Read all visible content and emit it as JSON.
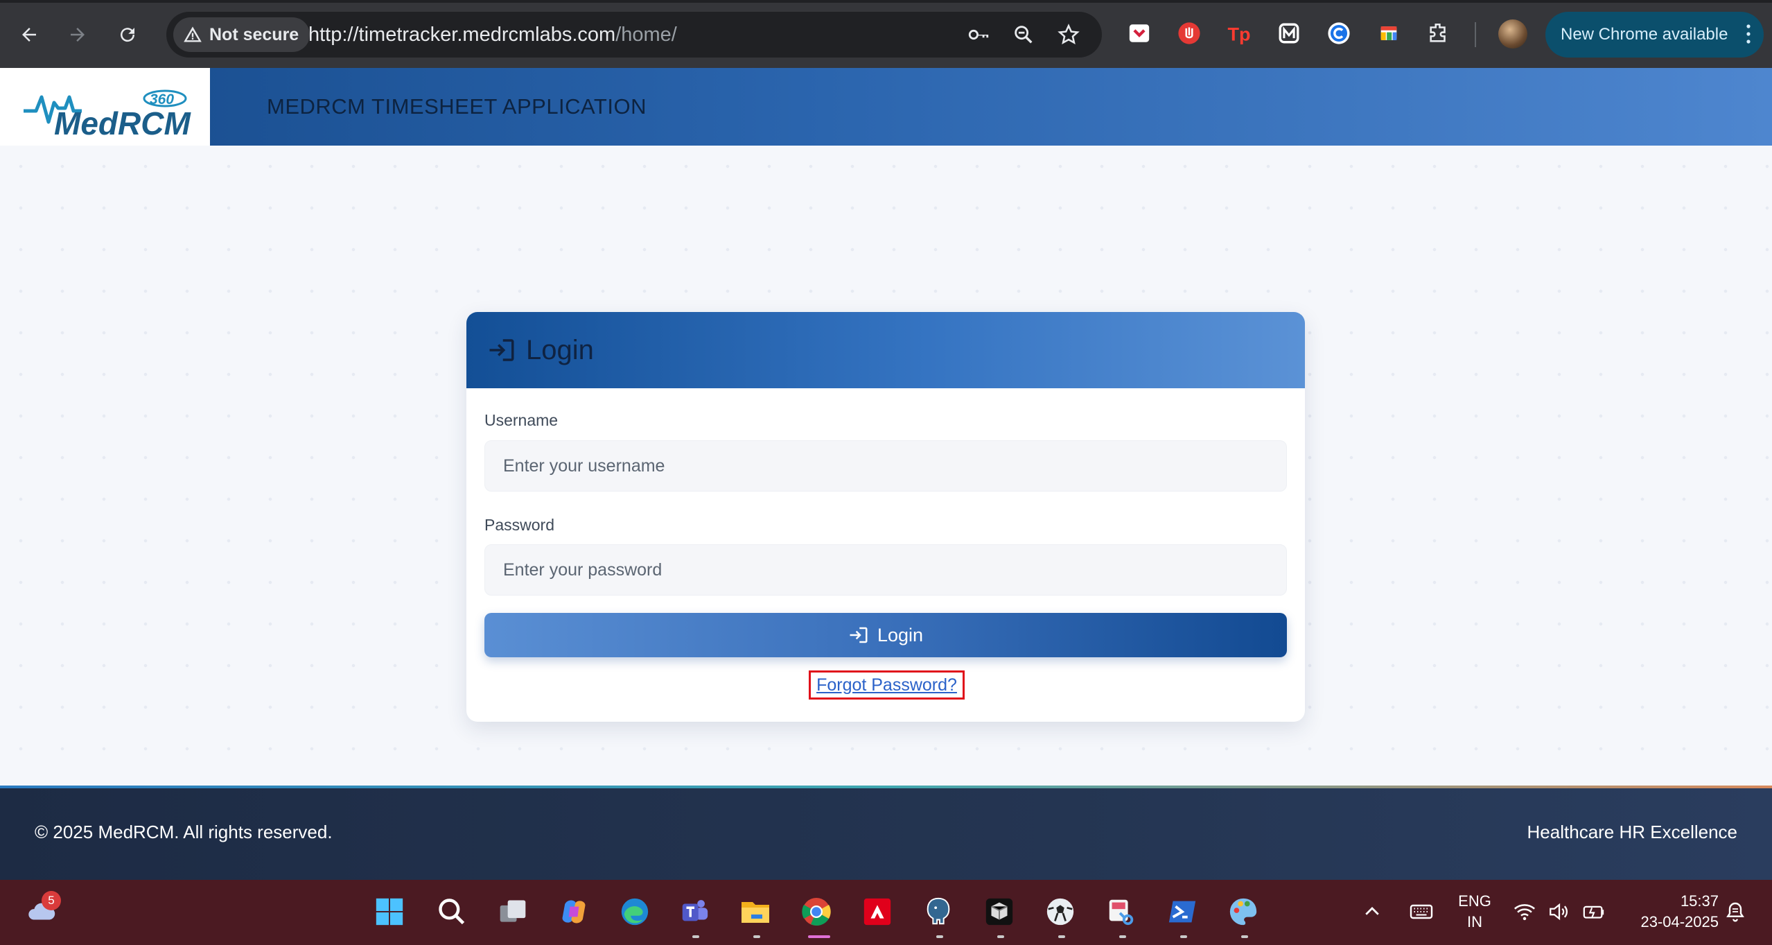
{
  "browser": {
    "security_label": "Not secure",
    "url_host": "http://timetracker.medrcmlabs.com",
    "url_path": "/home/",
    "update_label": "New Chrome available"
  },
  "app": {
    "logo_text": "MedRCM",
    "logo_badge": "360",
    "title": "MEDRCM TIMESHEET APPLICATION"
  },
  "login": {
    "heading": "Login",
    "username_label": "Username",
    "username_placeholder": "Enter your username",
    "password_label": "Password",
    "password_placeholder": "Enter your password",
    "submit_label": "Login",
    "forgot_label": "Forgot Password?"
  },
  "footer": {
    "copyright": "© 2025 MedRCM. All rights reserved.",
    "tagline": "Healthcare HR Excellence"
  },
  "taskbar": {
    "weather_badge": "5",
    "language_line1": "ENG",
    "language_line2": "IN",
    "time": "15:37",
    "date": "23-04-2025"
  }
}
